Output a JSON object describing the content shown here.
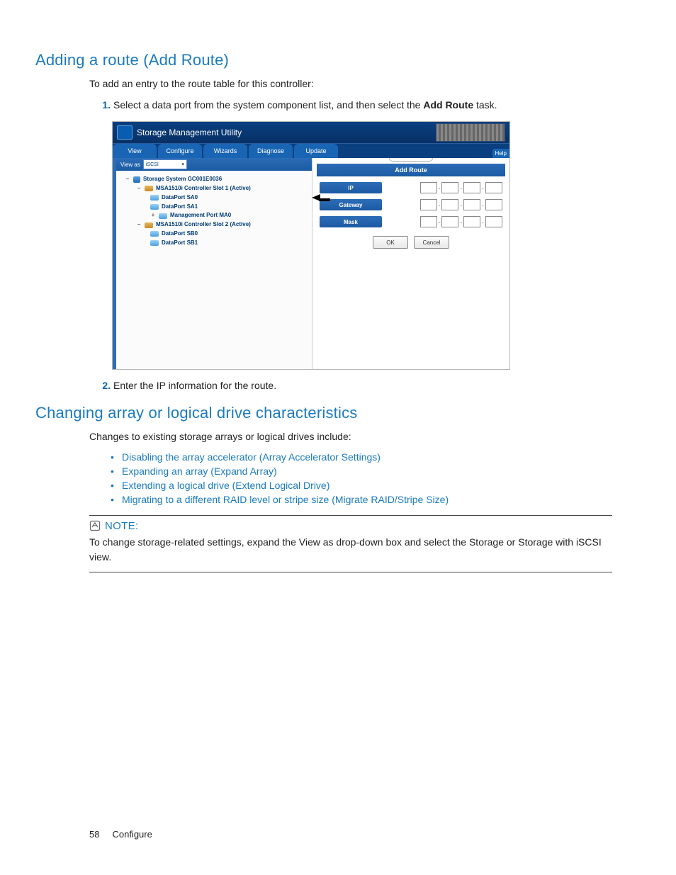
{
  "section1": {
    "heading": "Adding a route (Add Route)",
    "intro": "To add an entry to the route table for this controller:",
    "step1_pre": "Select a data port from the system component list, and then select the ",
    "step1_bold": "Add Route",
    "step1_post": " task.",
    "step2": "Enter the IP information for the route."
  },
  "figure": {
    "app_title": "Storage Management Utility",
    "tabs": [
      "View",
      "Configure",
      "Wizards",
      "Diagnose",
      "Update"
    ],
    "help": "Help",
    "viewas_label": "View as",
    "viewas_value": "iSCSI",
    "tree": {
      "root": "Storage System GC001E0036",
      "ctrl1": "MSA1510i Controller Slot 1 (Active)",
      "c1_p0": "DataPort SA0",
      "c1_p1": "DataPort SA1",
      "c1_m0": "Management Port MA0",
      "ctrl2": "MSA1510i Controller Slot 2 (Active)",
      "c2_p0": "DataPort SB0",
      "c2_p1": "DataPort SB1"
    },
    "pane_title": "Add Route",
    "labels": {
      "ip": "IP",
      "gateway": "Gateway",
      "mask": "Mask"
    },
    "buttons": {
      "ok": "OK",
      "cancel": "Cancel"
    }
  },
  "section2": {
    "heading": "Changing array or logical drive characteristics",
    "intro": "Changes to existing storage arrays or logical drives include:",
    "links": [
      "Disabling the array accelerator (Array Accelerator Settings)",
      "Expanding an array (Expand Array)",
      "Extending a logical drive (Extend Logical Drive)",
      "Migrating to a different RAID level or stripe size (Migrate RAID/Stripe Size)"
    ]
  },
  "note": {
    "label": "NOTE:",
    "text": "To change storage-related settings, expand the View as drop-down box and select the Storage or Storage with iSCSI view."
  },
  "footer": {
    "page": "58",
    "section": "Configure"
  }
}
